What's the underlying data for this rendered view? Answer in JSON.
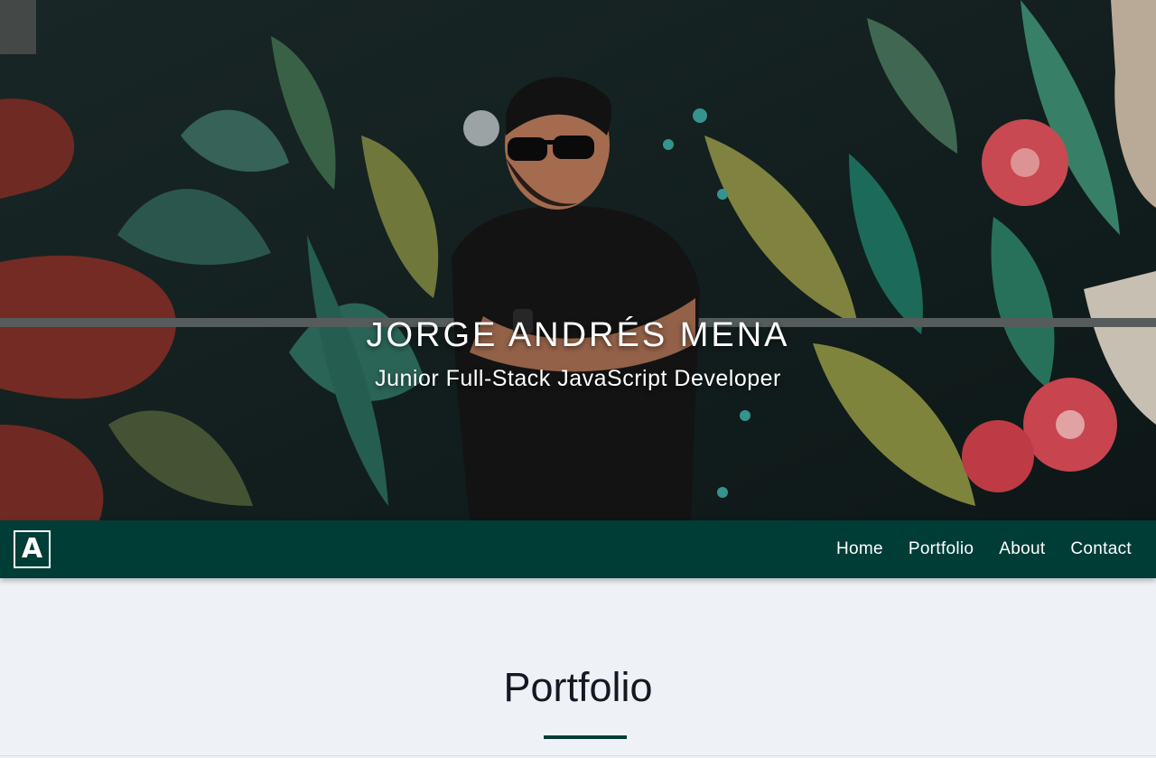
{
  "hero": {
    "name": "JORGE ANDRÉS MENA",
    "role": "Junior Full-Stack JavaScript Developer"
  },
  "navbar": {
    "logo_letter": "A",
    "links": [
      "Home",
      "Portfolio",
      "About",
      "Contact"
    ]
  },
  "portfolio": {
    "title": "Portfolio"
  },
  "colors": {
    "navbar_bg": "#003d37",
    "page_bg": "#eef2f6",
    "accent": "#003d37",
    "title_text": "#141823"
  }
}
